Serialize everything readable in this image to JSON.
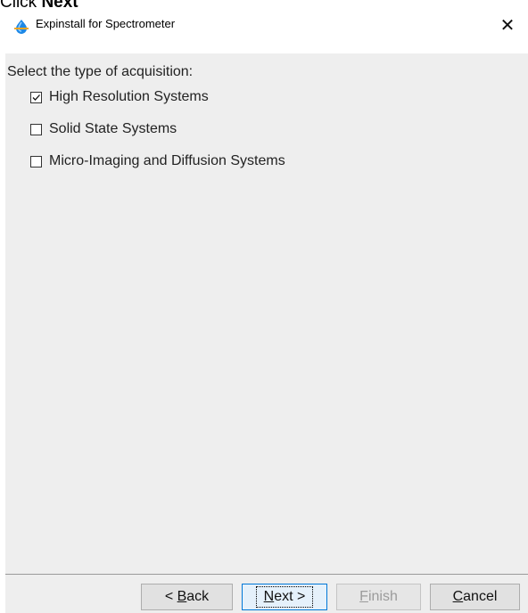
{
  "instruction": {
    "prefix": "Click ",
    "target": "Next"
  },
  "window": {
    "title": "Expinstall for Spectrometer",
    "close_glyph": "✕"
  },
  "prompt": "Select the type of acquisition:",
  "options": [
    {
      "label": "High Resolution Systems",
      "checked": true
    },
    {
      "label": "Solid State Systems",
      "checked": false
    },
    {
      "label": "Micro-Imaging and Diffusion Systems",
      "checked": false
    }
  ],
  "buttons": {
    "back": {
      "before": "< ",
      "mnemonic": "B",
      "after": "ack"
    },
    "next": {
      "before": "",
      "mnemonic": "N",
      "after": "ext >"
    },
    "finish": {
      "before": "",
      "mnemonic": "F",
      "after": "inish",
      "disabled": true
    },
    "cancel": {
      "before": "",
      "mnemonic": "C",
      "after": "ancel"
    }
  },
  "colors": {
    "panel": "#eeeeee",
    "focus_border": "#0078d7",
    "icon_blue": "#1e88e5"
  }
}
